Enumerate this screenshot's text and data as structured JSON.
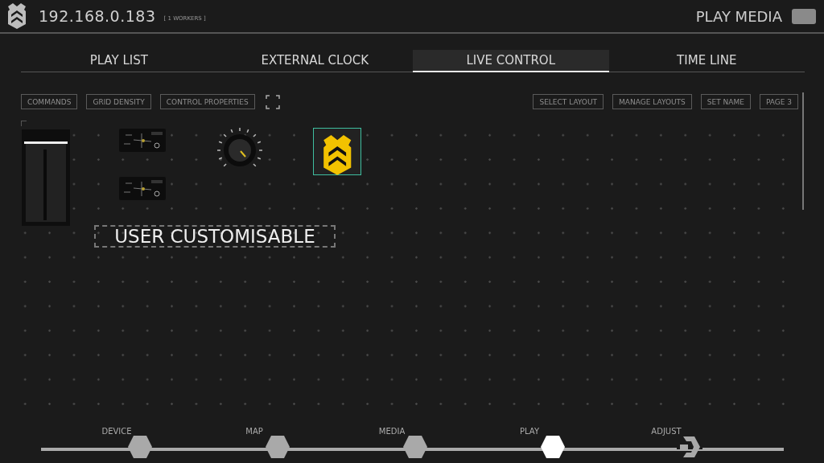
{
  "header": {
    "address": "192.168.0.183",
    "workers": "[ 1 WORKERS ]",
    "action": "PLAY MEDIA"
  },
  "tabs": [
    {
      "label": "PLAY LIST",
      "selected": false
    },
    {
      "label": "EXTERNAL CLOCK",
      "selected": false
    },
    {
      "label": "LIVE CONTROL",
      "selected": true
    },
    {
      "label": "TIME LINE",
      "selected": false
    }
  ],
  "toolbar_left": [
    "COMMANDS",
    "GRID DENSITY",
    "CONTROL PROPERTIES"
  ],
  "toolbar_right": [
    "SELECT LAYOUT",
    "MANAGE LAYOUTS",
    "SET NAME",
    "PAGE 3"
  ],
  "canvas": {
    "widgets": [
      {
        "kind": "fader"
      },
      {
        "kind": "panel"
      },
      {
        "kind": "panel"
      },
      {
        "kind": "knob"
      },
      {
        "kind": "logo",
        "selected": true
      },
      {
        "kind": "label",
        "text": "USER CUSTOMISABLE"
      }
    ]
  },
  "steps": [
    {
      "label": "DEVICE",
      "kind": "hex",
      "selected": false
    },
    {
      "label": "MAP",
      "kind": "hex",
      "selected": false
    },
    {
      "label": "MEDIA",
      "kind": "hex",
      "selected": false
    },
    {
      "label": "PLAY",
      "kind": "hex",
      "selected": true
    },
    {
      "label": "ADJUST",
      "kind": "adjust",
      "selected": false
    }
  ]
}
